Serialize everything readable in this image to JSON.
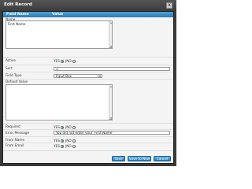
{
  "dialog": {
    "title": "Edit Record",
    "close_glyph": "x"
  },
  "columns": {
    "field_name": "Field Name",
    "value": "Value"
  },
  "fields": {
    "name": {
      "label": "Name",
      "value": "First Name"
    },
    "active": {
      "label": "Active",
      "yes": "YES",
      "no": "NO",
      "selected": "YES"
    },
    "sort": {
      "label": "Sort",
      "value": "1"
    },
    "field_type": {
      "label": "Field Type",
      "selected": "Input Box"
    },
    "default_value": {
      "label": "Default Value",
      "value": ""
    },
    "required": {
      "label": "Required",
      "yes": "YES",
      "no": "NO",
      "selected": "YES"
    },
    "error_message": {
      "label": "Error Message",
      "value": "You did not enter your 'First Name'"
    },
    "from_name": {
      "label": "From Name",
      "yes": "YES",
      "no": "NO",
      "selected": "YES"
    },
    "from_email": {
      "label": "From Email",
      "yes": "YES",
      "no": "NO",
      "selected": "YES"
    }
  },
  "buttons": {
    "save": "Save",
    "save_to_new": "Save to New",
    "cancel": "Cancel"
  },
  "colors": {
    "header": "#2b7ab3",
    "button": "#2b7ab3",
    "titlebar": "#3c3c3c"
  }
}
